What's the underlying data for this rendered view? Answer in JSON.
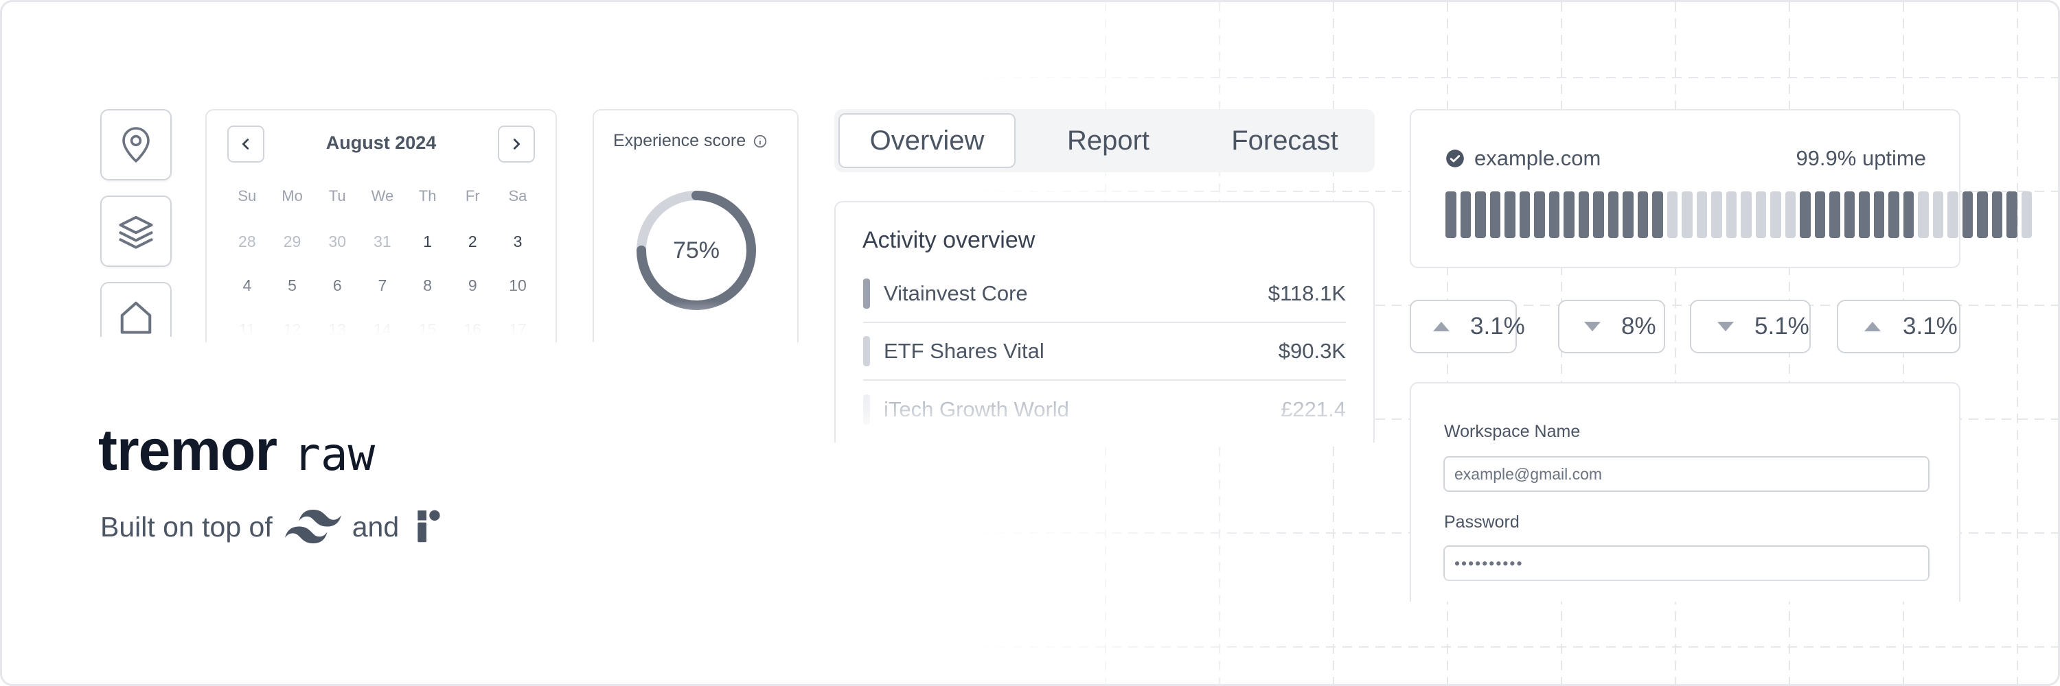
{
  "calendar": {
    "title": "August 2024",
    "weekdays": [
      "Su",
      "Mo",
      "Tu",
      "We",
      "Th",
      "Fr",
      "Sa"
    ],
    "weeks": [
      [
        "28",
        "29",
        "30",
        "31",
        "1",
        "2",
        "3"
      ],
      [
        "4",
        "5",
        "6",
        "7",
        "8",
        "9",
        "10"
      ],
      [
        "11",
        "12",
        "13",
        "14",
        "15",
        "16",
        "17"
      ]
    ]
  },
  "experience": {
    "label": "Experience score",
    "value_label": "75%",
    "value": 0.75
  },
  "tabs": [
    "Overview",
    "Report",
    "Forecast"
  ],
  "activity": {
    "title": "Activity overview",
    "rows": [
      {
        "name": "Vitainvest Core",
        "value": "$118.1K",
        "color": "#9ca3af"
      },
      {
        "name": "ETF Shares Vital",
        "value": "$90.3K",
        "color": "#d1d5db"
      },
      {
        "name": "iTech Growth World",
        "value": "£221.4",
        "color": "#e5e7eb"
      }
    ]
  },
  "uptime": {
    "domain": "example.com",
    "uptime_label": "99.9% uptime",
    "bar_colors": [
      "#6b7280",
      "#d1d5db",
      "#e5e7eb"
    ]
  },
  "deltas": [
    {
      "value": "3.1%",
      "direction": "up"
    },
    {
      "value": "8%",
      "direction": "down"
    },
    {
      "value": "5.1%",
      "direction": "down"
    },
    {
      "value": "3.1%",
      "direction": "up"
    }
  ],
  "form": {
    "workspace_label": "Workspace Name",
    "workspace_value": "example@gmail.com",
    "password_label": "Password",
    "password_value": "••••••••••"
  },
  "brand": {
    "name": "tremor",
    "suffix": "raw",
    "built_on": "Built on top of",
    "and": "and"
  },
  "icons": [
    "map-pin-icon",
    "layers-icon",
    "home-icon",
    "chevron-left-icon",
    "chevron-right-icon",
    "info-icon",
    "check-circle-icon",
    "tailwind-logo-icon",
    "radix-logo-icon"
  ]
}
